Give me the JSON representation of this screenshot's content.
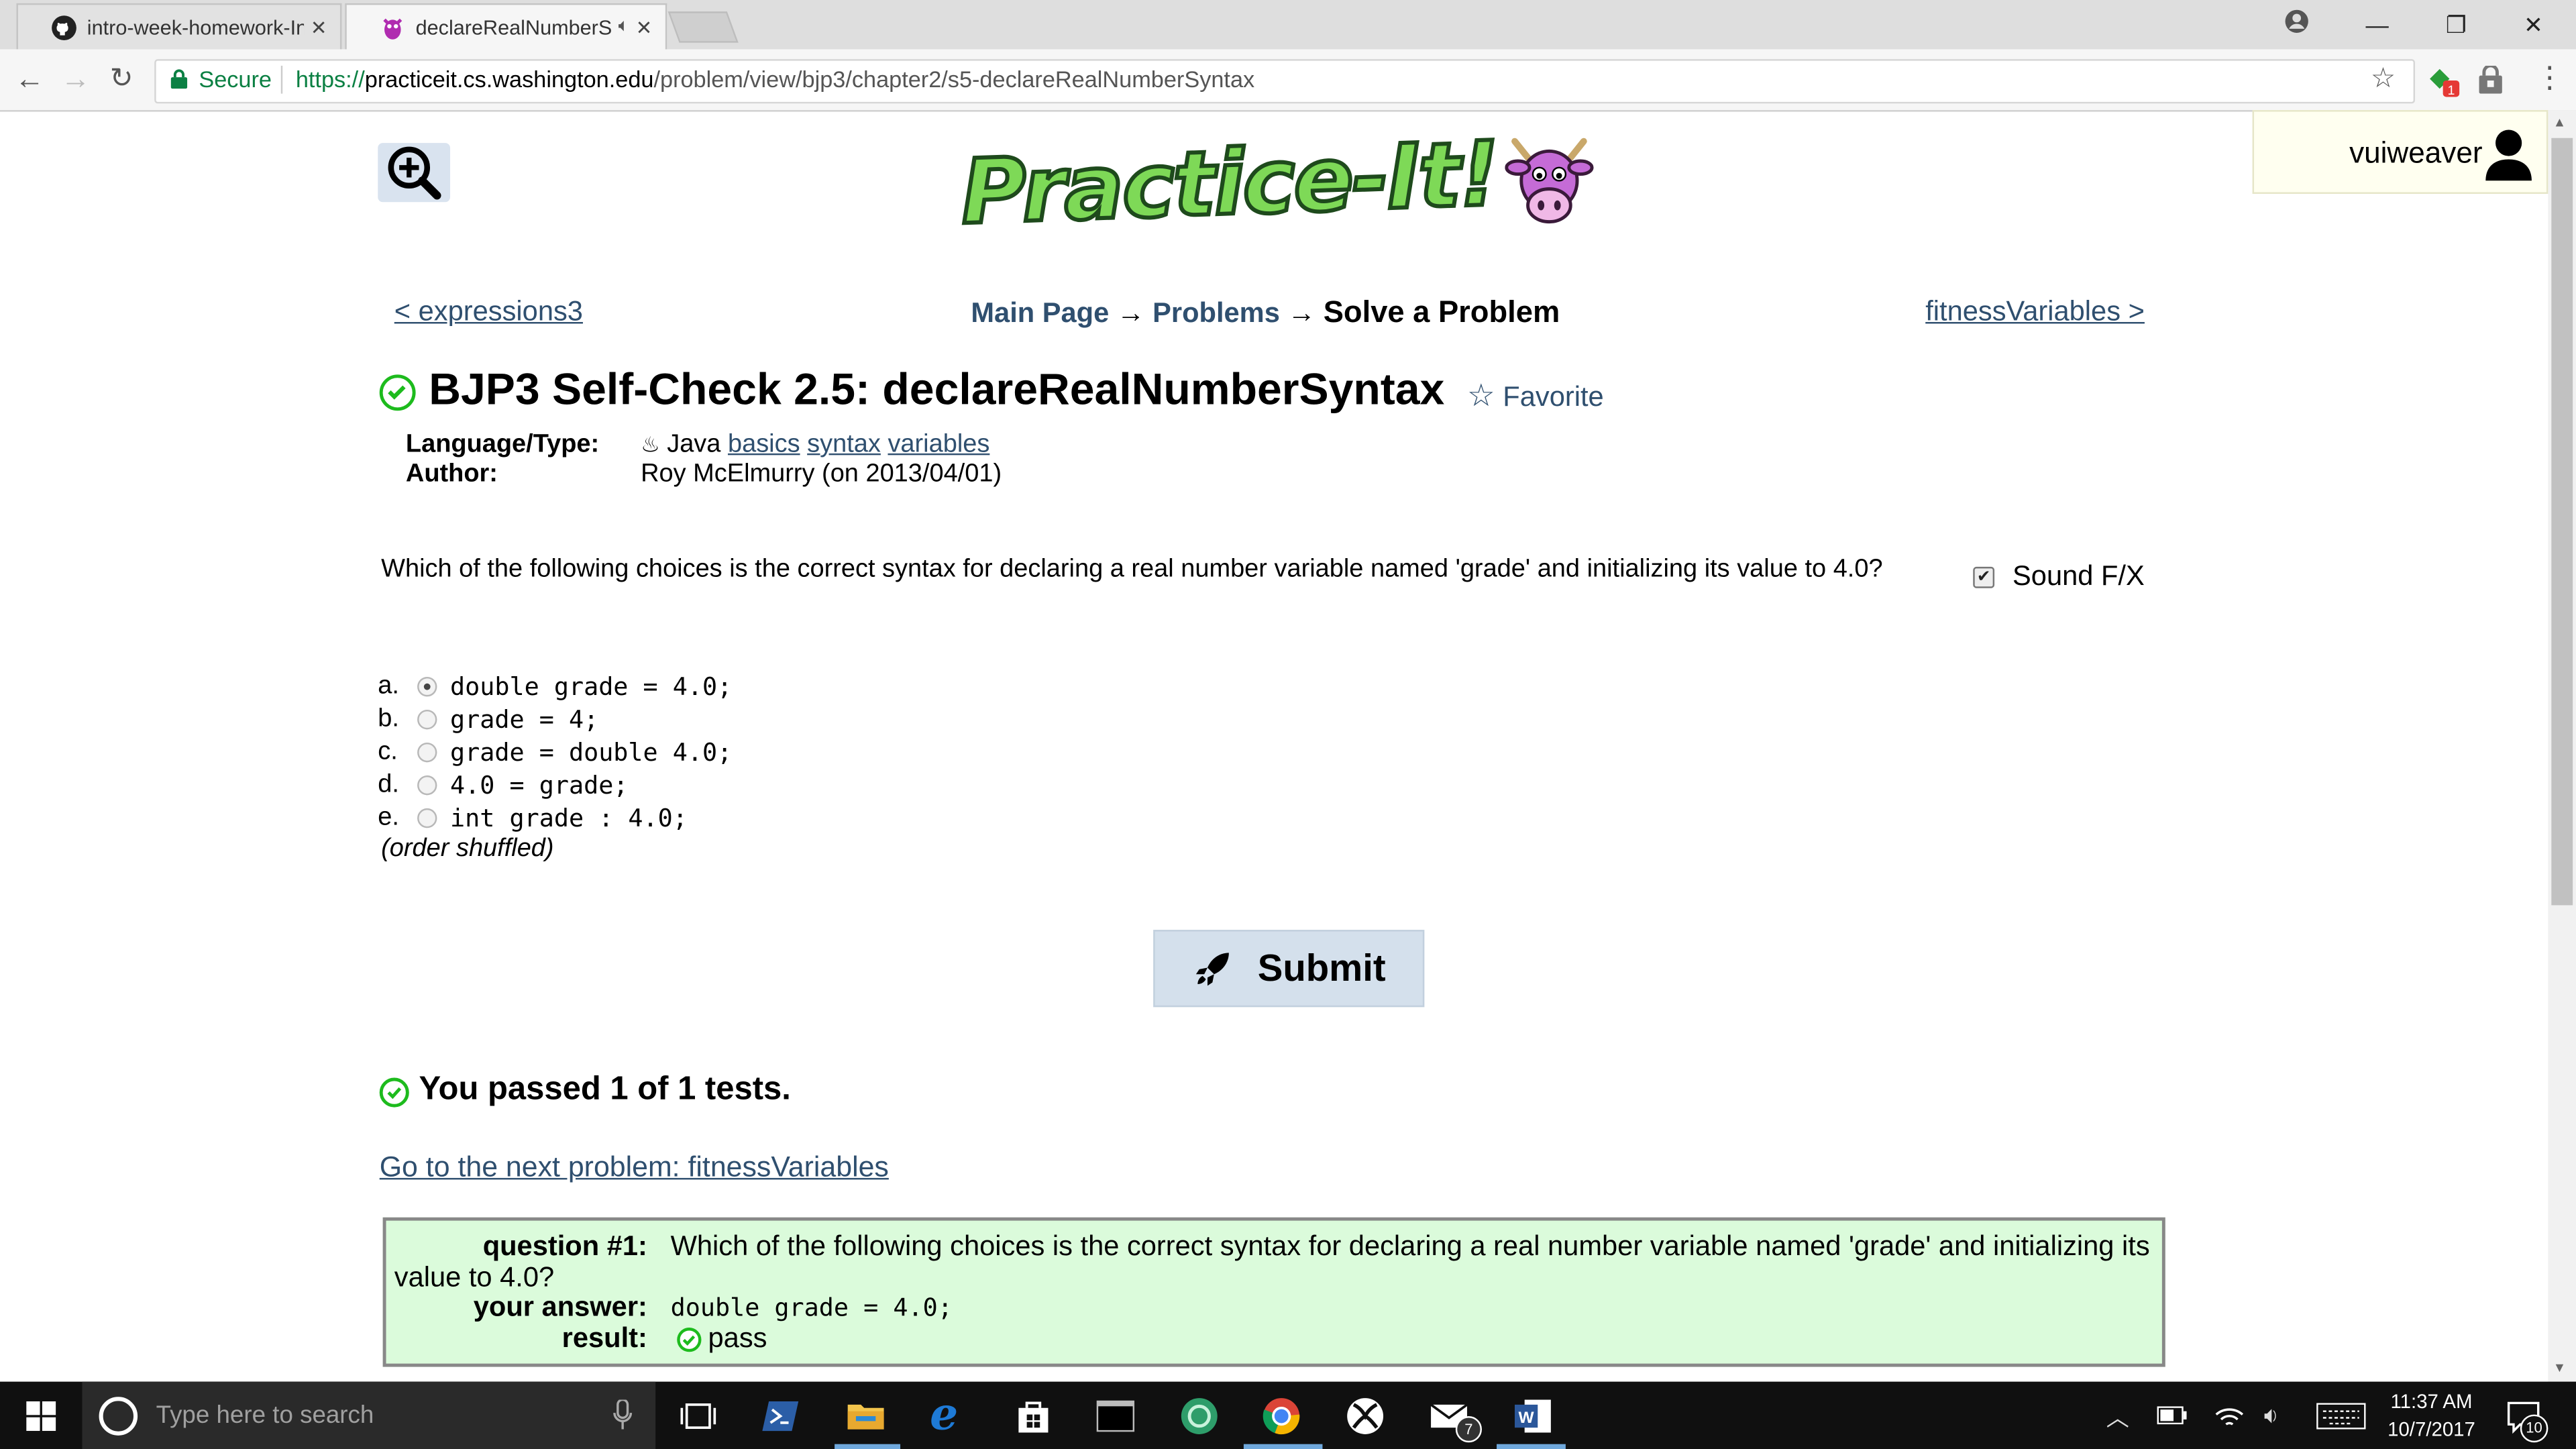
{
  "browser": {
    "tabs": [
      {
        "title": "intro-week-homework-In",
        "active": false
      },
      {
        "title": "declareRealNumberSy",
        "active": true
      }
    ],
    "secure_label": "Secure",
    "url": {
      "scheme": "https://",
      "host": "practiceit.cs.washington.edu",
      "path": "/problem/view/bjp3/chapter2/s5-declareRealNumberSyntax"
    },
    "extension_badge": "1"
  },
  "site": {
    "logo_text": "Practice-It!",
    "username": "vuiweaver"
  },
  "nav": {
    "prev": "< expressions3",
    "next": "fitnessVariables >",
    "breadcrumb": {
      "main": "Main Page",
      "arrow1": "→",
      "problems": "Problems",
      "arrow2": "→",
      "current": "Solve a Problem"
    }
  },
  "problem": {
    "title": "BJP3 Self-Check 2.5: declareRealNumberSyntax",
    "favorite": "Favorite",
    "language_label": "Language/Type:",
    "language": "Java",
    "tags": [
      "basics",
      "syntax",
      "variables"
    ],
    "author_label": "Author:",
    "author": "Roy McElmurry (on 2013/04/01)",
    "question": "Which of the following choices is the correct syntax for declaring a real number variable named 'grade' and initializing its value to 4.0?",
    "sound_label": "Sound F/X",
    "choices": [
      {
        "letter": "a.",
        "code": "double grade = 4.0;",
        "selected": true
      },
      {
        "letter": "b.",
        "code": "grade = 4;",
        "selected": false
      },
      {
        "letter": "c.",
        "code": "grade = double 4.0;",
        "selected": false
      },
      {
        "letter": "d.",
        "code": "4.0 = grade;",
        "selected": false
      },
      {
        "letter": "e.",
        "code": "int grade : 4.0;",
        "selected": false
      }
    ],
    "shuffle_note": "(order shuffled)",
    "submit_label": "Submit"
  },
  "result": {
    "summary": "You passed 1 of 1 tests.",
    "next_link": "Go to the next problem: fitnessVariables",
    "question_label": "question #1:",
    "question_text": "Which of the following choices is the correct syntax for declaring a real number variable named 'grade' and initializing its value to 4.0?",
    "answer_label": "your answer:",
    "answer": "double grade = 4.0;",
    "result_label": "result:",
    "result": "pass"
  },
  "taskbar": {
    "search_placeholder": "Type here to search",
    "time": "11:37 AM",
    "date": "10/7/2017",
    "mail_badge": "7",
    "notification_count": "10"
  }
}
